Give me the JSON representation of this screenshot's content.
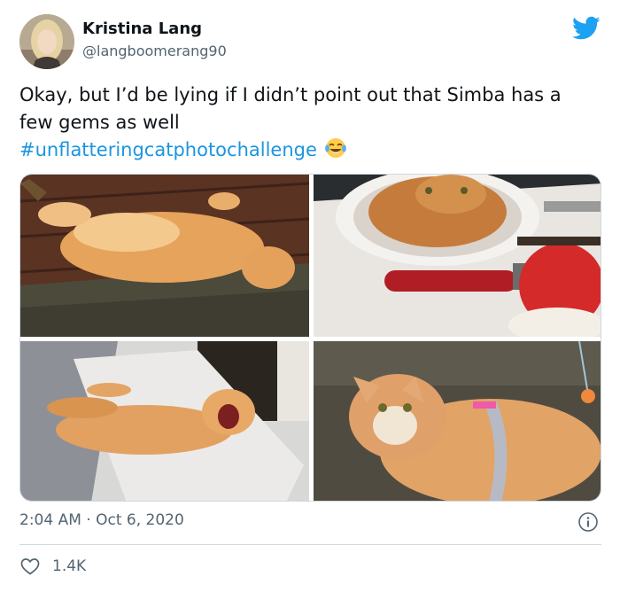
{
  "user": {
    "display_name": "Kristina Lang",
    "handle": "@langboomerang90"
  },
  "tweet": {
    "text": "Okay, but I’d be lying if I didn’t point out that Simba has a few gems as well",
    "hashtag": "#unflatteringcatphotochallenge",
    "emoji": "face-with-tears-of-joy"
  },
  "photos": [
    {
      "subject": "orange cat lying on its back on wooden floor"
    },
    {
      "subject": "orange cat sitting in bathroom sink with red brush"
    },
    {
      "subject": "orange cat yawning on bed"
    },
    {
      "subject": "orange cat wearing harness on carpet"
    }
  ],
  "meta": {
    "time": "2:04 AM",
    "separator": "·",
    "date": "Oct 6, 2020"
  },
  "engagement": {
    "likes": "1.4K"
  },
  "colors": {
    "link": "#1b95e0",
    "secondary_text": "#536471",
    "twitter_blue": "#1da1f2"
  },
  "icons": [
    "twitter-bird-icon",
    "info-icon",
    "heart-icon"
  ]
}
